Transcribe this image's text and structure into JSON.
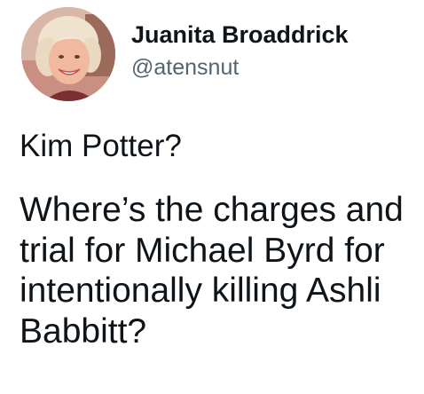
{
  "author": {
    "display_name": "Juanita Broaddrick",
    "handle": "@atensnut"
  },
  "tweet": {
    "line_1": "Kim Potter?",
    "line_2": "Where’s the charges and trial for Michael Byrd for intentionally killing Ashli Babbitt?"
  },
  "colors": {
    "text_primary": "#0f1419",
    "text_secondary": "#536471",
    "background": "#ffffff"
  },
  "icons": {
    "avatar": "profile-photo"
  }
}
